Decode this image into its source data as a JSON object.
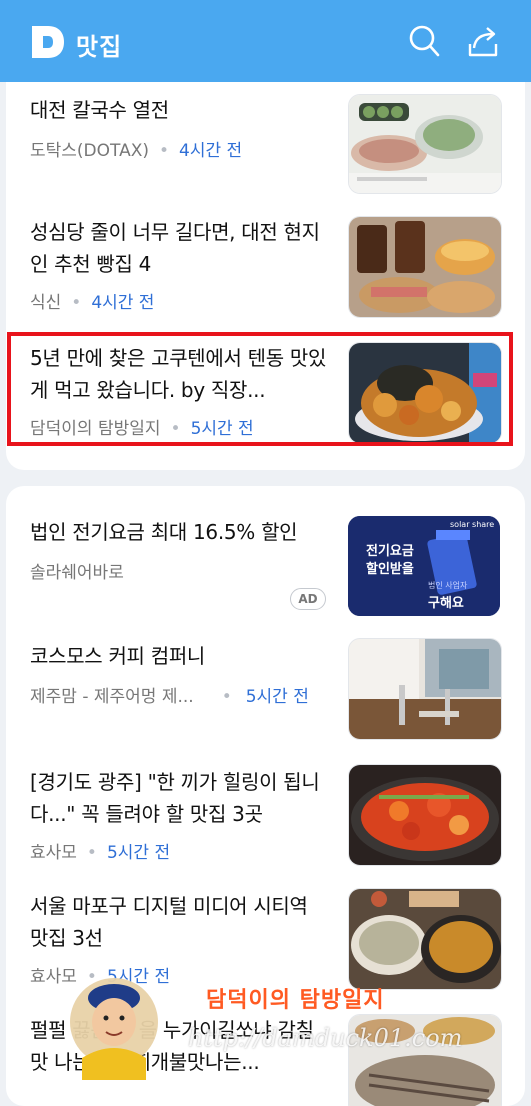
{
  "header": {
    "logo_letter": "D",
    "title": "맛집",
    "bg_color": "#4aa8f0"
  },
  "icons": {
    "search": "search-icon",
    "share": "share-icon"
  },
  "card1": {
    "items": [
      {
        "title": "대전 칼국수 열전",
        "source": "도탁스(DOTAX)",
        "time": "4시간 전"
      },
      {
        "title": "성심당 줄이 너무 길다면, 대전 현지인 추천 빵집 4",
        "source": "식신",
        "time": "4시간 전"
      },
      {
        "title": "5년 만에 찾은 고쿠텐에서 텐동 맛있게 먹고 왔습니다. by 직장...",
        "source": "담덕이의 탐방일지",
        "time": "5시간 전"
      }
    ]
  },
  "card2": {
    "items": [
      {
        "title": "법인 전기요금 최대 16.5% 할인",
        "source": "솔라쉐어바로",
        "badge": "AD"
      },
      {
        "title": "코스모스 커피 컴퍼니",
        "source": "제주맘 - 제주어멍 제...",
        "time": "5시간 전"
      },
      {
        "title": "[경기도 광주] \"한 끼가 힐링이 됩니다...\" 꼭 들려야 할 맛집 3곳",
        "source": "효사모",
        "time": "5시간 전"
      },
      {
        "title": "서울 마포구 디지털 미디어 시티역 맛집 3선",
        "source": "효사모",
        "time": "5시간 전"
      },
      {
        "title": "펄펄 끓는 ... 을 누가이길쏘냐 감칠맛 나는 김치찌개불맛나는...",
        "source": "",
        "time": ""
      }
    ]
  },
  "ad_thumb": {
    "line1": "전기요금",
    "line2": "할인받을",
    "line3": "구해요",
    "small": "법인 사업자",
    "brand": "solar share"
  },
  "watermark": {
    "text": "담덕이의 탐방일지",
    "url": "http://damduck01.com"
  },
  "colors": {
    "accent": "#2f6fd6",
    "highlight": "#e8131b"
  }
}
